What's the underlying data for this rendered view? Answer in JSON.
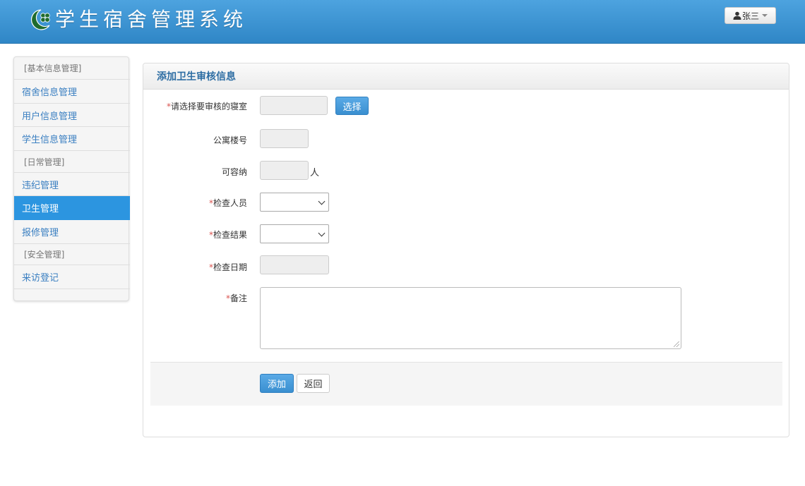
{
  "header": {
    "app_title": "学生宿舍管理系统",
    "logo_icon": "clover-crescent-logo",
    "user_name": "张三",
    "brand_color": "#3a93d3"
  },
  "sidebar": {
    "groups": [
      {
        "title": "[基本信息管理]",
        "items": [
          "宿舍信息管理",
          "用户信息管理",
          "学生信息管理"
        ]
      },
      {
        "title": "[日常管理]",
        "items": [
          "违纪管理",
          "卫生管理",
          "报修管理"
        ]
      },
      {
        "title": "[安全管理]",
        "items": [
          "来访登记"
        ]
      }
    ],
    "active_item": "卫生管理"
  },
  "panel": {
    "title": "添加卫生审核信息"
  },
  "form": {
    "dorm_label": "请选择要审核的寝室",
    "select_button": "选择",
    "building_label": "公寓楼号",
    "capacity_label": "可容纳",
    "capacity_unit": "人",
    "inspector_label": "检查人员",
    "result_label": "检查结果",
    "date_label": "检查日期",
    "remark_label": "备注",
    "required_mark": "*"
  },
  "actions": {
    "add_label": "添加",
    "back_label": "返回"
  }
}
